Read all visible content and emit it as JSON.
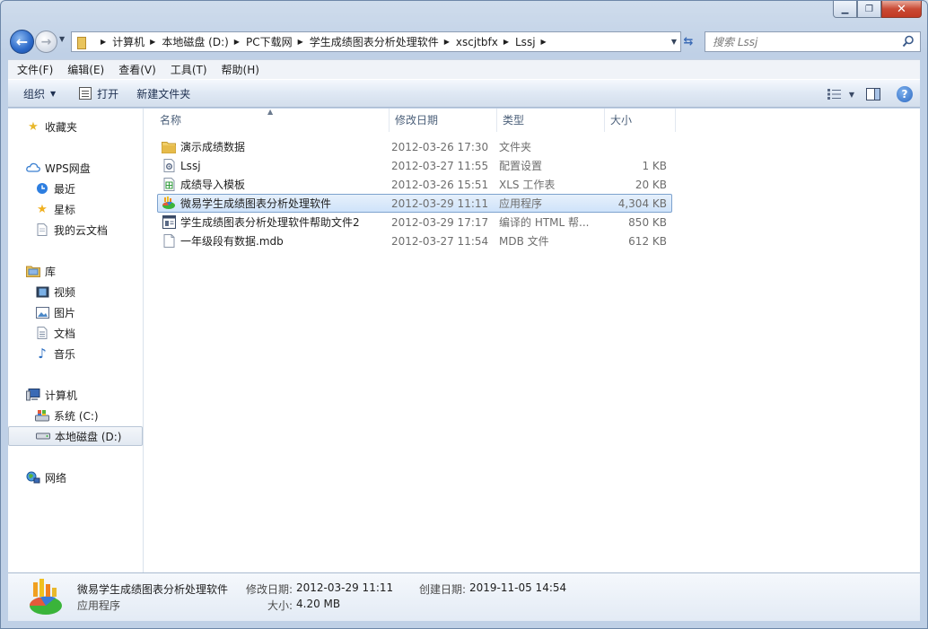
{
  "window": {
    "minimize_glyph": "▁",
    "maximize_glyph": "❐",
    "close_glyph": "✕"
  },
  "nav": {
    "back_glyph": "←",
    "forward_glyph": "→",
    "breadcrumbs": [
      "计算机",
      "本地磁盘 (D:)",
      "PC下载网",
      "学生成绩图表分析处理软件",
      "xscjtbfx",
      "Lssj"
    ],
    "search_placeholder": "搜索 Lssj"
  },
  "menubar": [
    "文件(F)",
    "编辑(E)",
    "查看(V)",
    "工具(T)",
    "帮助(H)"
  ],
  "commandbar": {
    "organize": "组织",
    "open": "打开",
    "new_folder": "新建文件夹",
    "help": "?"
  },
  "sidebar": {
    "favorites": "收藏夹",
    "wps": "WPS网盘",
    "wps_items": [
      "最近",
      "星标",
      "我的云文档"
    ],
    "library": "库",
    "library_items": [
      "视频",
      "图片",
      "文档",
      "音乐"
    ],
    "computer": "计算机",
    "computer_items": [
      "系统 (C:)",
      "本地磁盘 (D:)"
    ],
    "network": "网络"
  },
  "columns": {
    "name": "名称",
    "date": "修改日期",
    "type": "类型",
    "size": "大小"
  },
  "files": [
    {
      "name": "演示成绩数据",
      "date": "2012-03-26 17:30",
      "type": "文件夹",
      "size": "",
      "icon": "folder-icon"
    },
    {
      "name": "Lssj",
      "date": "2012-03-27 11:55",
      "type": "配置设置",
      "size": "1 KB",
      "icon": "config-file-icon"
    },
    {
      "name": "成绩导入模板",
      "date": "2012-03-26 15:51",
      "type": "XLS 工作表",
      "size": "20 KB",
      "icon": "spreadsheet-icon"
    },
    {
      "name": "微易学生成绩图表分析处理软件",
      "date": "2012-03-29 11:11",
      "type": "应用程序",
      "size": "4,304 KB",
      "icon": "application-icon"
    },
    {
      "name": "学生成绩图表分析处理软件帮助文件2",
      "date": "2012-03-29 17:17",
      "type": "编译的 HTML 帮...",
      "size": "850 KB",
      "icon": "help-file-icon"
    },
    {
      "name": "一年级段有数据.mdb",
      "date": "2012-03-27 11:54",
      "type": "MDB 文件",
      "size": "612 KB",
      "icon": "blank-file-icon"
    }
  ],
  "details": {
    "name": "微易学生成绩图表分析处理软件",
    "type": "应用程序",
    "modified_label": "修改日期:",
    "modified_value": "2012-03-29 11:11",
    "created_label": "创建日期:",
    "created_value": "2019-11-05 14:54",
    "size_label": "大小:",
    "size_value": "4.20 MB"
  },
  "colors": {
    "selection": "#cfe3fa",
    "selection_border": "#7da2ce",
    "folder": "#e9c45c"
  }
}
